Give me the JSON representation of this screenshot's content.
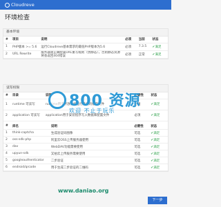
{
  "brand": {
    "logo_text": "Cloudreve"
  },
  "page": {
    "title": "环境检查"
  },
  "env_section": {
    "title": "基本环境",
    "headers": [
      "#",
      "项目",
      "说明",
      "必须",
      "当前",
      "状态"
    ],
    "rows": [
      {
        "num": "1",
        "item": "PHP版本 >= 5.6",
        "desc": "运行Cloudreve基本需求的最低PHP版本为5.6",
        "required": "必须",
        "current": "7.3.5",
        "status": "满足"
      },
      {
        "num": "2",
        "item": "URL Rewrite",
        "desc": "服务器需正确配置URL重写规则（伪静态），否则静态资源将会返回404错误",
        "required": "必须",
        "current": "正常",
        "status": "满足"
      }
    ]
  },
  "dir_section": {
    "title": "读写权限",
    "headers": [
      "#",
      "目录",
      "说明",
      "必要性",
      "状态"
    ],
    "rows": [
      {
        "num": "1",
        "dir": "runtime 可读写",
        "desc": "runtime用于存放系统运行产生的缓存文件",
        "required": "必须",
        "status": "满足"
      },
      {
        "num": "2",
        "dir": "application 可读写",
        "desc": "application用于安装程序写入数据库配置文件",
        "required": "必须",
        "status": "满足"
      }
    ]
  },
  "func_section": {
    "headers": [
      "#",
      "库名",
      "说明",
      "必要性",
      "状态"
    ],
    "rows": [
      {
        "num": "1",
        "lib": "think-captcha",
        "desc": "生成验证码图像",
        "required": "可选",
        "status": "满足"
      },
      {
        "num": "2",
        "lib": "oss-sdk-php",
        "desc": "阿里云OSS上传服务器使用",
        "required": "可选",
        "status": "满足"
      },
      {
        "num": "3",
        "lib": "dav",
        "desc": "WebDAV功能需要使用",
        "required": "可选",
        "status": "满足"
      },
      {
        "num": "4",
        "lib": "upyun-sdk",
        "desc": "又拍云上传服务需要使用",
        "required": "可选",
        "status": "满足"
      },
      {
        "num": "5",
        "lib": "googleauthenticator",
        "desc": "二步验证",
        "required": "可选",
        "status": "满足"
      },
      {
        "num": "6",
        "lib": "endroid/qrcode",
        "desc": "用于生成二步验证的二维码",
        "required": "可选",
        "status": "满足"
      }
    ]
  },
  "actions": {
    "next_label": "下一步"
  },
  "watermark": {
    "big": "800 资源",
    "sub": "欢迎 不止于玩乐",
    "url": "www.daniao.org"
  },
  "colors": {
    "primary": "#2d6ecf",
    "ok": "#3aa655"
  }
}
